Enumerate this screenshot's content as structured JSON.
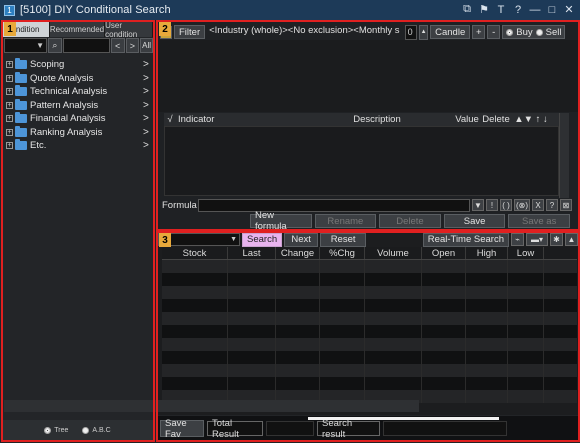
{
  "window": {
    "icon_label": "1",
    "title": "[5100] DIY Conditional Search",
    "controls": [
      "⧉",
      "⚑",
      "T",
      "?",
      "—",
      "□",
      "✕"
    ]
  },
  "annotations": [
    "1",
    "2",
    "3"
  ],
  "left": {
    "tabs": [
      "ondition",
      "Recommended",
      "User condition"
    ],
    "search_nav": [
      "<",
      ">",
      "All"
    ],
    "tree_items": [
      {
        "label": "Scoping",
        "arrow": ">"
      },
      {
        "label": "Quote Analysis",
        "arrow": ">"
      },
      {
        "label": "Technical Analysis",
        "arrow": ">"
      },
      {
        "label": "Pattern Analysis",
        "arrow": ">"
      },
      {
        "label": "Financial Analysis",
        "arrow": ">"
      },
      {
        "label": "Ranking Analysis",
        "arrow": ">"
      },
      {
        "label": "Etc.",
        "arrow": ">"
      }
    ],
    "view_modes": [
      {
        "label": "Tree",
        "selected": true
      },
      {
        "label": "A.B.C",
        "selected": false
      }
    ]
  },
  "top_panel": {
    "filter_label": "Filter",
    "condition_text": "<Industry (whole)><No exclusion><Monthly s",
    "spin_value": "0",
    "candle_label": "Candle",
    "plus_label": "+",
    "minus_label": "-",
    "buy_label": "Buy",
    "sell_label": "Sell",
    "columns": {
      "check": "√",
      "indicator": "Indicator",
      "description": "Description",
      "value": "Value",
      "delete": "Delete",
      "sort": "▲▼ ↑ ↓"
    },
    "formula_label": "Formula",
    "formula_tools": [
      "▼",
      "!",
      "( )",
      "(⊗)",
      "X",
      "?",
      "⊠"
    ],
    "actions": [
      {
        "label": "New formula",
        "enabled": true
      },
      {
        "label": "Rename",
        "enabled": false
      },
      {
        "label": "Delete",
        "enabled": false
      },
      {
        "label": "Save",
        "enabled": true
      },
      {
        "label": "Save as",
        "enabled": false
      }
    ]
  },
  "results_panel": {
    "search_label": "Search",
    "next_label": "Next",
    "reset_label": "Reset",
    "realtime_label": "Real-Time Search",
    "columns": [
      "Stock",
      "Last",
      "Change",
      "%Chg",
      "Volume",
      "Open",
      "High",
      "Low"
    ],
    "accent_color": "#e8b3ee"
  },
  "status_bar": {
    "save_fav": "Save Fav",
    "total_result": "Total Result",
    "search_result": "Search result"
  },
  "colors": {
    "highlight_box": "#e02020",
    "badge": "#e8a93b",
    "folder": "#4d95d8",
    "titlebar": "#1d3a58"
  }
}
